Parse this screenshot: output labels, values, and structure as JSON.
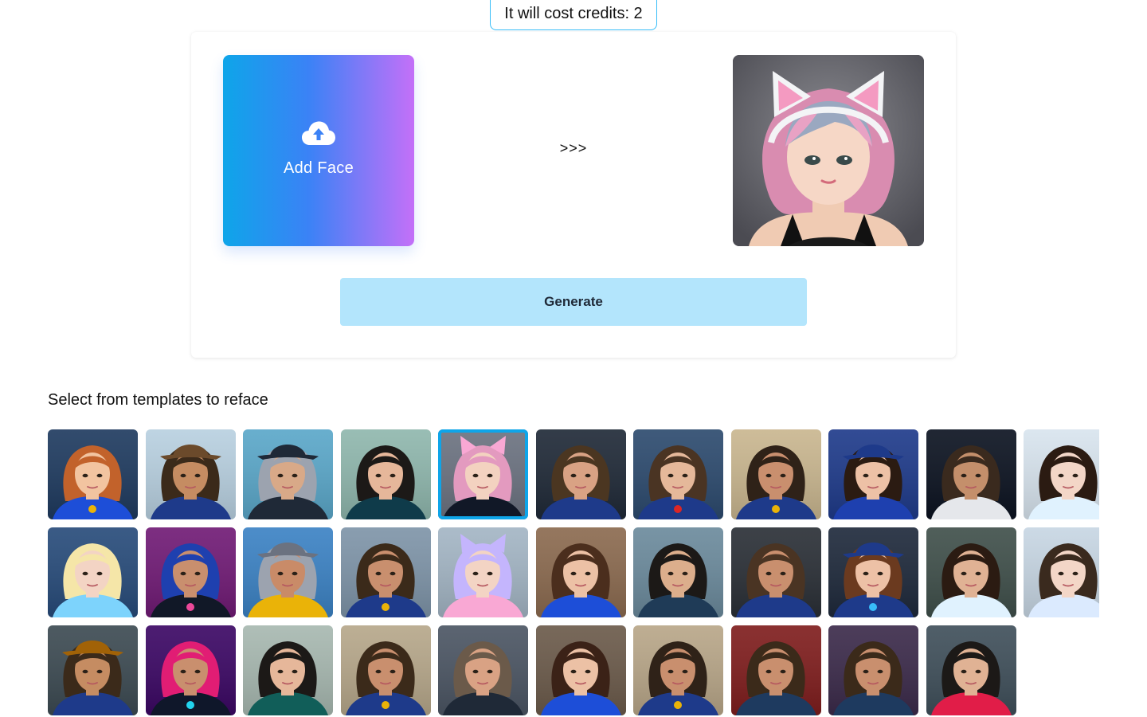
{
  "header": {
    "credits_text": "It will cost credits: 2"
  },
  "upload": {
    "label": "Add Face",
    "icon": "cloud-upload-icon"
  },
  "arrow_text": ">>>",
  "preview": {
    "name": "pink-cat-ear-girl"
  },
  "generate_label": "Generate",
  "templates": {
    "title": "Select from templates to reface",
    "selected_index": 4,
    "rows": [
      [
        {
          "bg": "#1e3a5f",
          "hair": "#c2622b",
          "skin": "#f2c4a0",
          "outfit": "#1d4ed8",
          "accent": "#eab308"
        },
        {
          "bg": "#b8d0e0",
          "hair": "#3b2a1a",
          "skin": "#c58c62",
          "outfit": "#1e3a8a",
          "hat": "#6b4a2b"
        },
        {
          "bg": "#5aa7c9",
          "hair": "#9ca3af",
          "skin": "#d8a988",
          "outfit": "#1f2937",
          "hat": "#1f2937"
        },
        {
          "bg": "#8fb7ad",
          "hair": "#1c1917",
          "skin": "#e6b79a",
          "outfit": "#0f3b4a"
        },
        {
          "bg": "#6b7280",
          "hair": "#e39abf",
          "skin": "#f3d2c0",
          "outfit": "#111827",
          "ears": "#f9a8d4"
        },
        {
          "bg": "#1f2937",
          "hair": "#4b3621",
          "skin": "#d9a284",
          "outfit": "#1e3a8a"
        },
        {
          "bg": "#2c4a6e",
          "hair": "#4a3423",
          "skin": "#e5b89a",
          "outfit": "#1e3a8a",
          "accent": "#dc2626"
        },
        {
          "bg": "#c9b68f",
          "hair": "#2f2218",
          "skin": "#c98f6e",
          "outfit": "#1e3a8a",
          "accent": "#eab308"
        },
        {
          "bg": "#1e3a8a",
          "hair": "#2b1b12",
          "skin": "#edc1a6",
          "outfit": "#1e40af",
          "hat": "#1e3a8a"
        },
        {
          "bg": "#0b1220",
          "hair": "#3a2a1e",
          "skin": "#c48f6b",
          "outfit": "#e5e7eb"
        },
        {
          "bg": "#d8e4ee",
          "hair": "#2b1b12",
          "skin": "#f3d6c7",
          "outfit": "#e0f2fe"
        }
      ],
      [
        {
          "bg": "#274b7a",
          "hair": "#f5e6a8",
          "skin": "#f3d4c4",
          "outfit": "#7dd3fc"
        },
        {
          "bg": "#701a75",
          "hair": "#1e40af",
          "skin": "#c98f6e",
          "outfit": "#111827",
          "accent": "#ec4899"
        },
        {
          "bg": "#3b82c4",
          "hair": "#9ca3af",
          "skin": "#c98b68",
          "outfit": "#eab308",
          "hat": "#6b7280"
        },
        {
          "bg": "#7e94a8",
          "hair": "#3b2a1a",
          "skin": "#c98f6e",
          "outfit": "#1e3a8a",
          "accent": "#eab308"
        },
        {
          "bg": "#a3b5c4",
          "hair": "#c4b5fd",
          "skin": "#f3d4c4",
          "outfit": "#f9a8d4",
          "ears": "#c4b5fd"
        },
        {
          "bg": "#8b6a4f",
          "hair": "#4b2e1d",
          "skin": "#ecc1a5",
          "outfit": "#1d4ed8"
        },
        {
          "bg": "#6b8a9c",
          "hair": "#1c1917",
          "skin": "#dcae8c",
          "outfit": "#1f3b57"
        },
        {
          "bg": "#2a2f36",
          "hair": "#4a3423",
          "skin": "#c98f6e",
          "outfit": "#1e3a8a"
        },
        {
          "bg": "#1e293b",
          "hair": "#6b3a1f",
          "skin": "#edc1a6",
          "outfit": "#1e3a8a",
          "hat": "#1e3a8a",
          "accent": "#38bdf8"
        },
        {
          "bg": "#3f4f4a",
          "hair": "#2b1b12",
          "skin": "#e0b294",
          "outfit": "#e0f2fe"
        },
        {
          "bg": "#c7d6e3",
          "hair": "#3a2a1e",
          "skin": "#f3d6c7",
          "outfit": "#dbeafe"
        }
      ],
      [
        {
          "bg": "#3c4a52",
          "hair": "#3b2a1a",
          "skin": "#c58c62",
          "outfit": "#1e3a8a",
          "hat": "#a16207"
        },
        {
          "bg": "#3b0764",
          "hair": "#e11d74",
          "skin": "#c98f6e",
          "outfit": "#0f172a",
          "accent": "#22d3ee"
        },
        {
          "bg": "#a7b8b0",
          "hair": "#1c1917",
          "skin": "#e6b79a",
          "outfit": "#115e59"
        },
        {
          "bg": "#b6a78a",
          "hair": "#3b2a1a",
          "skin": "#c98f6e",
          "outfit": "#1e3a8a",
          "accent": "#eab308"
        },
        {
          "bg": "#4b5563",
          "hair": "#6b5a4a",
          "skin": "#d9a284",
          "outfit": "#1f2937"
        },
        {
          "bg": "#6b5a4a",
          "hair": "#3b2217",
          "skin": "#ecc1a5",
          "outfit": "#1d4ed8"
        },
        {
          "bg": "#b8a688",
          "hair": "#2f2218",
          "skin": "#c98f6e",
          "outfit": "#1e3a8a",
          "accent": "#eab308"
        },
        {
          "bg": "#7f1d1d",
          "hair": "#3b2a1a",
          "skin": "#c98f6e",
          "outfit": "#1e3a5f"
        },
        {
          "bg": "#3b2a4a",
          "hair": "#3b2a1a",
          "skin": "#c98f6e",
          "outfit": "#1e3a5f"
        },
        {
          "bg": "#3f4f5a",
          "hair": "#1c1917",
          "skin": "#e0b294",
          "outfit": "#e11d48"
        }
      ]
    ]
  }
}
